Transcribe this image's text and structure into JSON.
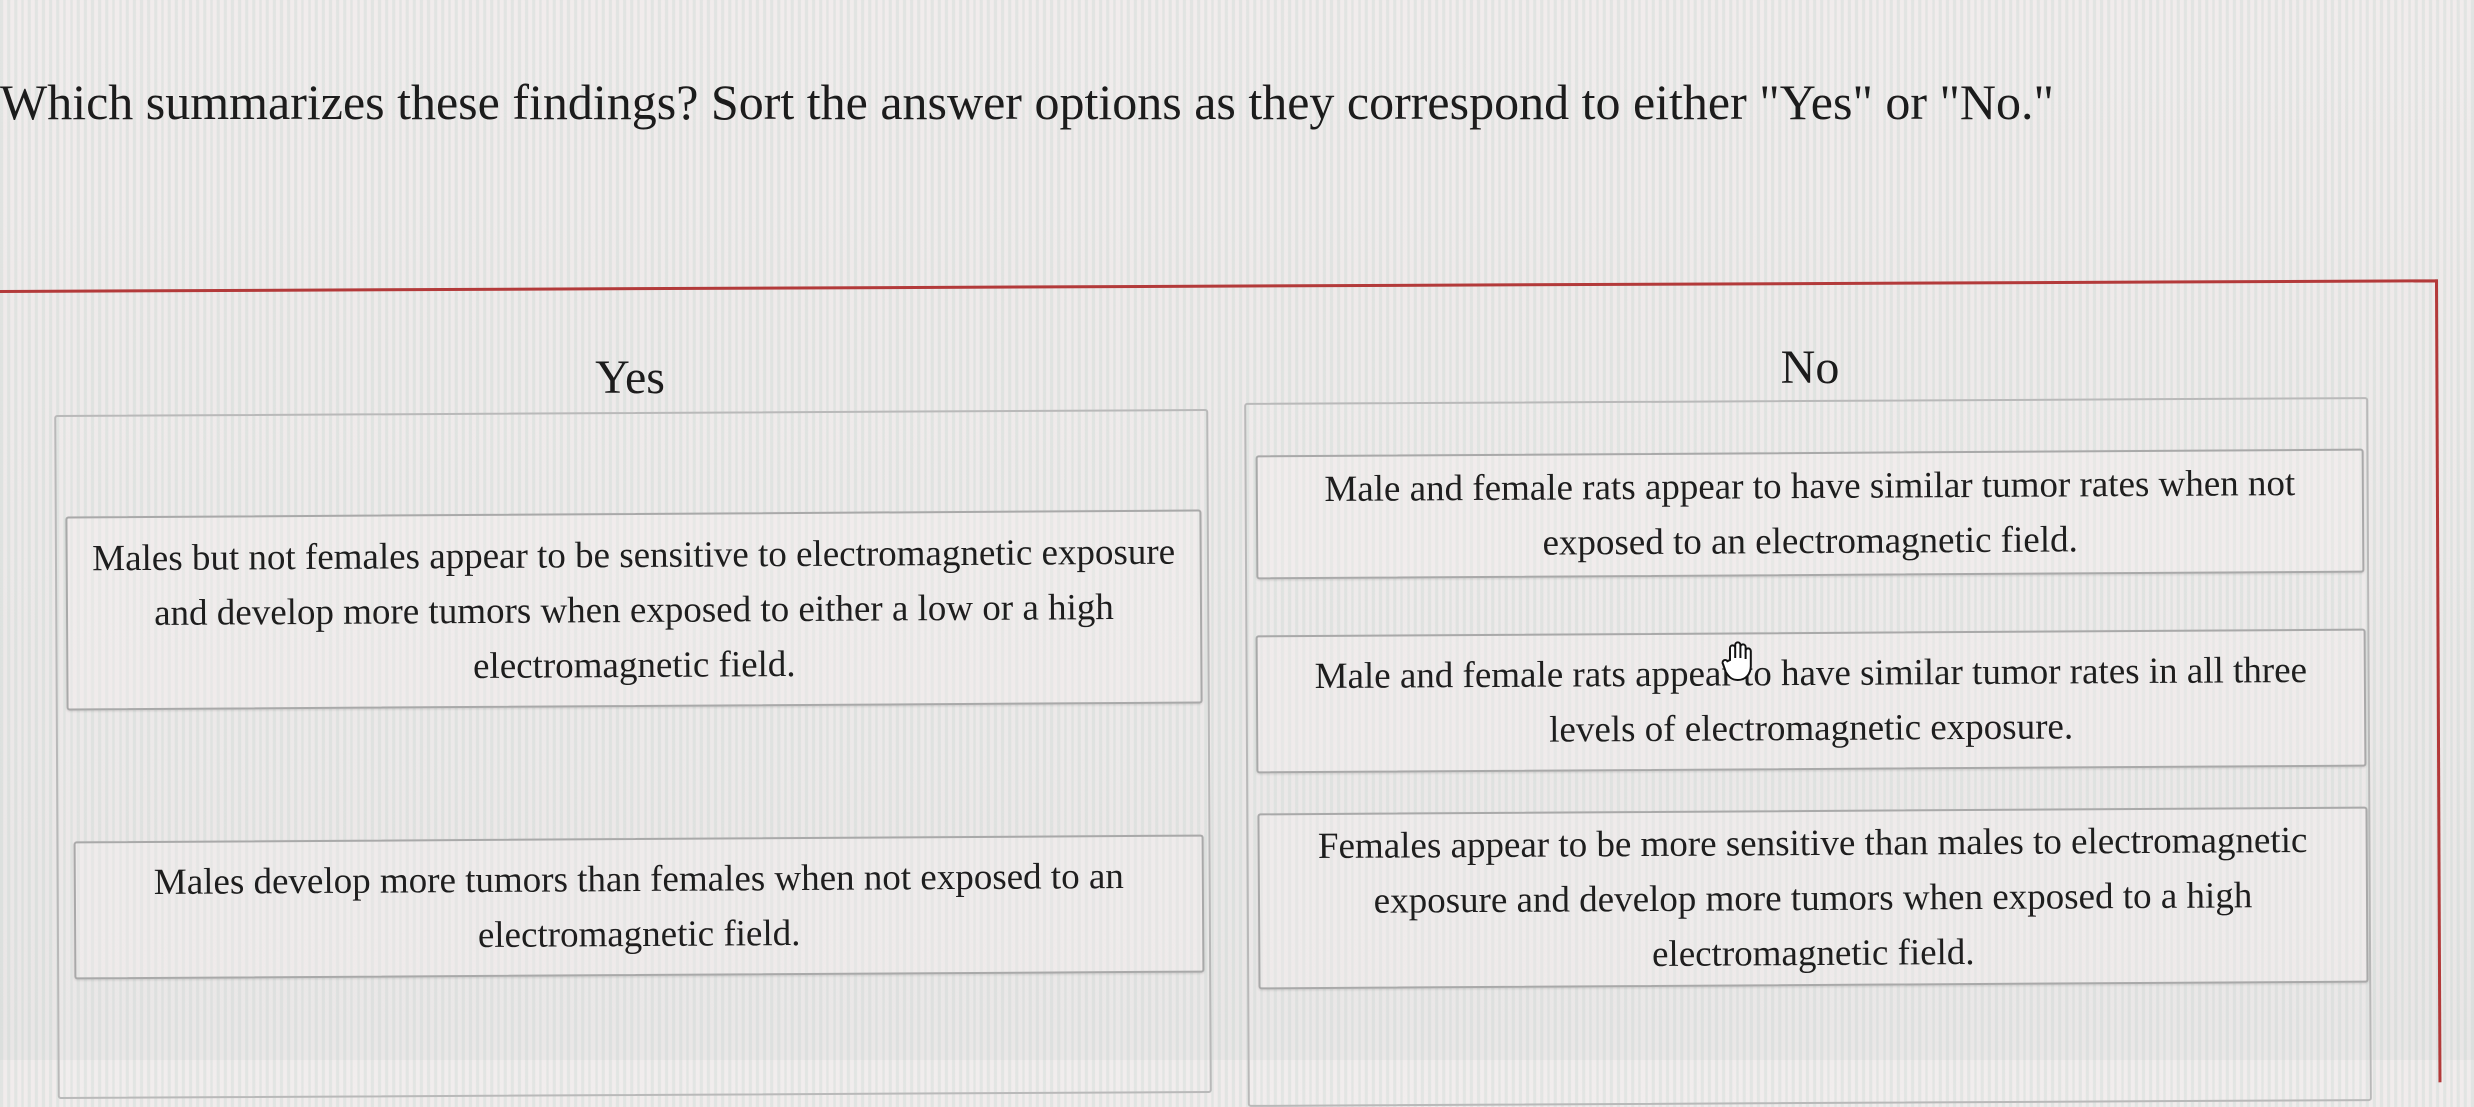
{
  "question": {
    "text": "Which summarizes these findings? Sort the answer options as they correspond to either \"Yes\" or \"No.\""
  },
  "columns": {
    "yes": {
      "title": "Yes",
      "cards": [
        {
          "text": "Males but not females appear to be sensitive to electromagnetic exposure and develop more tumors when exposed to either a low or a high electromagnetic field."
        },
        {
          "text": "Males develop more tumors than females when not exposed to an electromagnetic field."
        }
      ]
    },
    "no": {
      "title": "No",
      "cards": [
        {
          "text": "Male and female rats appear to have similar tumor rates when not exposed to an electromagnetic field."
        },
        {
          "text": "Male and female rats appear to have similar tumor rates in all three levels of electromagnetic exposure."
        },
        {
          "text": "Females appear to be more sensitive than males to electromagnetic exposure and develop more tumors when exposed to a high electromagnetic field."
        }
      ]
    }
  },
  "colors": {
    "frame_border": "#b33a3a",
    "card_border": "#a9a9a9",
    "text": "#1e1e1e"
  },
  "icons": {
    "cursor": "hand-grab-icon"
  }
}
